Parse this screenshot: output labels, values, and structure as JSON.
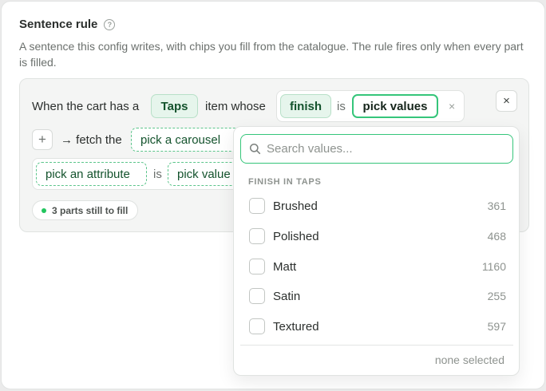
{
  "header": {
    "title": "Sentence rule",
    "help_icon": "?",
    "description": "A sentence this config writes, with chips you fill from the catalogue. The rule fires only when every part is filled."
  },
  "sentence": {
    "intro": "When the cart has a",
    "category_chip": "Taps",
    "item_whose": "item whose",
    "attribute_chip": "finish",
    "is_1": "is",
    "values_chip": "pick values",
    "clear_mark": "×",
    "remove_mark": "×",
    "add_mark": "+",
    "fetch_text": "→ fetch the",
    "carousel_chip": "pick a carousel",
    "attribute_placeholder": "pick an attribute",
    "is_2": "is",
    "value_placeholder": "pick value"
  },
  "status": {
    "text": "3 parts still to fill"
  },
  "dropdown": {
    "search_placeholder": "Search values...",
    "group_heading": "FINISH IN TAPS",
    "options": [
      {
        "label": "Brushed",
        "count": "361"
      },
      {
        "label": "Polished",
        "count": "468"
      },
      {
        "label": "Matt",
        "count": "1160"
      },
      {
        "label": "Satin",
        "count": "255"
      },
      {
        "label": "Textured",
        "count": "597"
      }
    ],
    "footer": "none selected"
  },
  "colors": {
    "accent": "#35c57a",
    "chip_fill": "#e6f5ec",
    "chip_text": "#14532d",
    "status_dot": "#22c55e"
  }
}
